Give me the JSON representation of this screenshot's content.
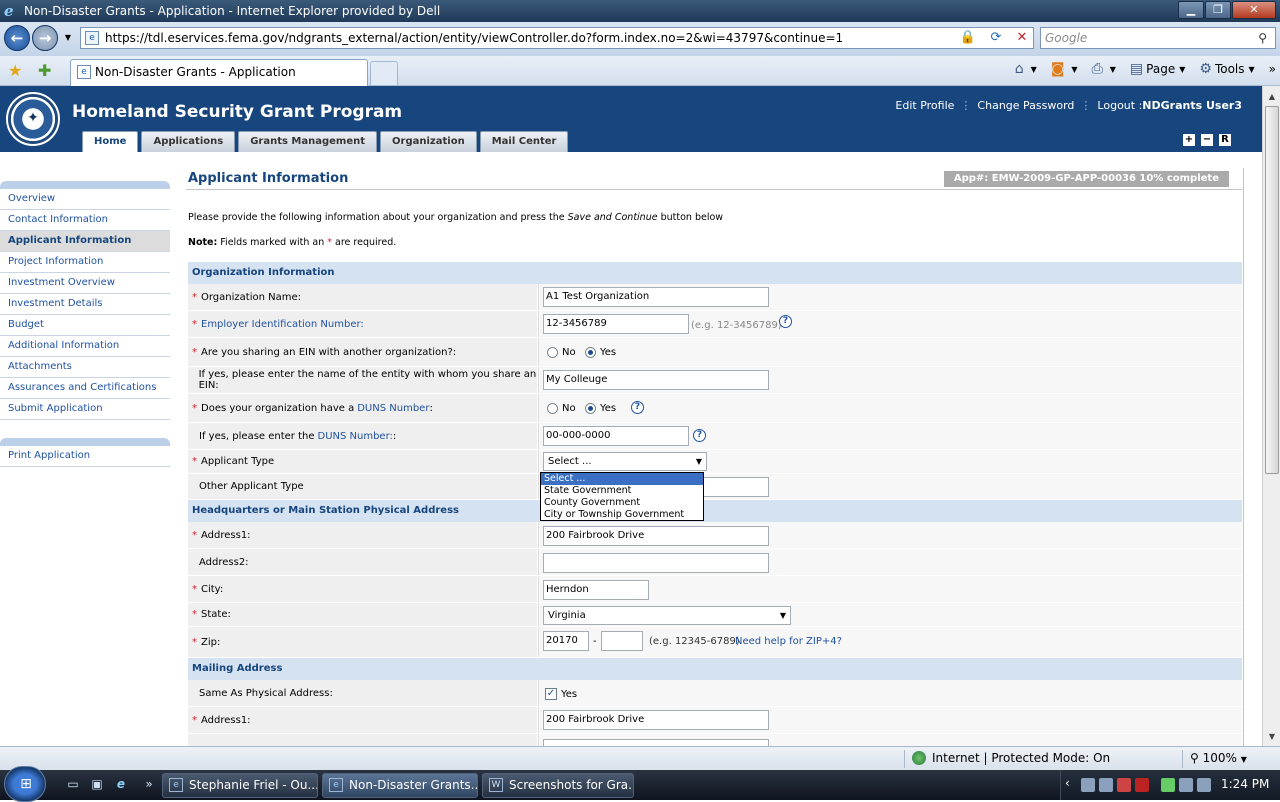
{
  "browser": {
    "window_title": "Non-Disaster Grants - Application - Internet Explorer provided by Dell",
    "url": "https://tdl.eservices.fema.gov/ndgrants_external/action/entity/viewController.do?form.index.no=2&wi=43797&continue=1",
    "search_placeholder": "Google",
    "tab_title": "Non-Disaster Grants - Application",
    "cmd_page": "Page",
    "cmd_tools": "Tools",
    "status_zone": "Internet | Protected Mode: On",
    "zoom": "100%"
  },
  "header": {
    "title": "Homeland Security Grant Program",
    "links": [
      "Edit Profile",
      "Change Password"
    ],
    "logout": "Logout :",
    "user": "NDGrants User3",
    "tabs": [
      "Home",
      "Applications",
      "Grants Management",
      "Organization",
      "Mail Center"
    ],
    "controls": [
      "+",
      "−",
      "R"
    ]
  },
  "sidebar": {
    "items": [
      "Overview",
      "Contact Information",
      "Applicant Information",
      "Project Information",
      "Investment Overview",
      "Investment Details",
      "Budget",
      "Additional Information",
      "Attachments",
      "Assurances and Certifications",
      "Submit Application"
    ],
    "active": "Applicant Information",
    "print": "Print Application"
  },
  "content": {
    "title": "Applicant Information",
    "progress": "App#: EMW-2009-GP-APP-00036 10% complete",
    "intro_a": "Please provide the following information about your organization and press the ",
    "intro_em": "Save and Continue",
    "intro_b": " button below",
    "note_label": "Note:",
    "note_a": " Fields marked with an ",
    "note_star": "*",
    "note_b": " are required."
  },
  "org": {
    "section": "Organization Information",
    "org_name_label": "Organization Name:",
    "org_name": "A1 Test Organization",
    "ein_label": "Employer Identification Number:",
    "ein": "12-3456789",
    "ein_hint": "(e.g. 12-3456789)",
    "share_ein_label": "Are you sharing an EIN with another organization?:",
    "no": "No",
    "yes": "Yes",
    "share_entity_label": "If yes, please enter the name of the entity with whom you share an EIN:",
    "share_entity": "My Colleuge",
    "duns_q_a": "Does your organization have a ",
    "duns_q_link": "DUNS Number",
    "duns_q_b": ":",
    "duns_label_a": "If yes, please enter the ",
    "duns_label_link": "DUNS Number:",
    "duns_label_b": ":",
    "duns": "00-000-0000",
    "applicant_type_label": "Applicant Type",
    "applicant_type": "Select ...",
    "applicant_type_options": [
      "Select ...",
      "State Government",
      "County Government",
      "City or Township Government"
    ],
    "other_type_label": "Other Applicant Type"
  },
  "hq": {
    "section": "Headquarters or Main Station Physical Address",
    "address1_label": "Address1:",
    "address1": "200 Fairbrook Drive",
    "address2_label": "Address2:",
    "city_label": "City:",
    "city": "Herndon",
    "state_label": "State:",
    "state": "Virginia",
    "zip_label": "Zip:",
    "zip": "20170",
    "zip_dash": "-",
    "zip_hint": "(e.g. 12345-6789)",
    "zip_help": "Need help for ZIP+4?"
  },
  "mailing": {
    "section": "Mailing Address",
    "same_label": "Same As Physical Address:",
    "same_value": "Yes",
    "address1_label": "Address1:",
    "address1": "200 Fairbrook Drive"
  },
  "taskbar": {
    "buttons": [
      "Stephanie Friel - Ou...",
      "Non-Disaster Grants...",
      "Screenshots for Gra..."
    ],
    "clock": "1:24 PM"
  }
}
